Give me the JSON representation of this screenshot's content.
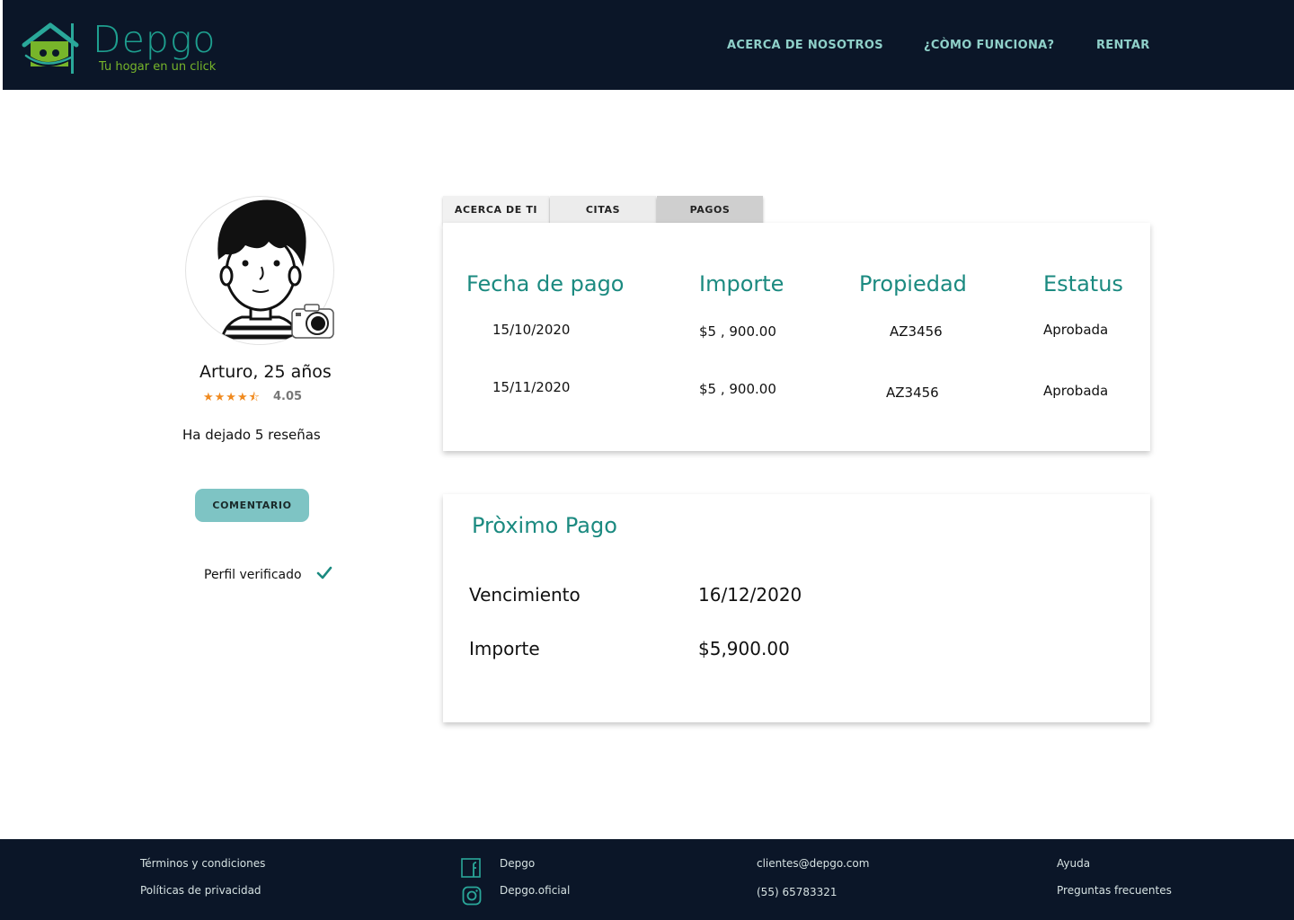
{
  "header": {
    "brand": "Depgo",
    "tagline": "Tu hogar en un click",
    "nav": [
      {
        "label": "ACERCA DE NOSOTROS"
      },
      {
        "label": "¿CÒMO FUNCIONA?"
      },
      {
        "label": "RENTAR"
      }
    ]
  },
  "profile": {
    "name": "Arturo, 25 años",
    "stars": "★★★★⯪",
    "rating": "4.05",
    "reviews": "Ha dejado 5 reseñas",
    "comment_button": "COMENTARIO",
    "verified": "Perfil verificado"
  },
  "tabs": [
    {
      "label": "ACERCA DE TI"
    },
    {
      "label": "CITAS"
    },
    {
      "label": "PAGOS",
      "active": true
    }
  ],
  "payments": {
    "headers": [
      "Fecha de pago",
      "Importe",
      "Propiedad",
      "Estatus"
    ],
    "rows": [
      [
        "15/10/2020",
        "$5 , 900.00",
        "AZ3456",
        "Aprobada"
      ],
      [
        "15/11/2020",
        "$5 , 900.00",
        "AZ3456",
        "Aprobada"
      ]
    ]
  },
  "next_payment": {
    "title": "Pròximo Pago",
    "due_label": "Vencimiento",
    "due_value": "16/12/2020",
    "amount_label": "Importe",
    "amount_value": "$5,900.00"
  },
  "footer": {
    "terms": "Términos y condiciones",
    "privacy": "Políticas  de privacidad",
    "facebook": "Depgo",
    "instagram": "Depgo.oficial",
    "email": "clientes@depgo.com",
    "phone": "(55) 65783321",
    "help": "Ayuda",
    "faq": "Preguntas frecuentes"
  },
  "colors": {
    "header_bg": "#0b1628",
    "accent": "#1b8a80",
    "button": "#7ec4c4",
    "stars": "#f08a1f",
    "tagline": "#77b52a"
  },
  "icons": [
    "house-logo-icon",
    "camera-icon",
    "check-icon",
    "facebook-icon",
    "instagram-icon"
  ]
}
